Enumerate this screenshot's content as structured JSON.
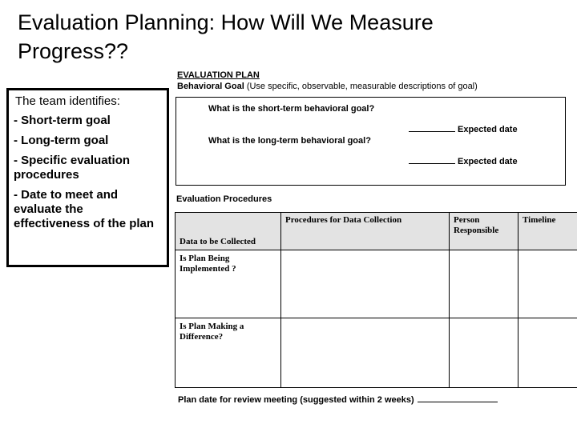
{
  "slide": {
    "title": "Evaluation Planning: How Will We Measure Progress??"
  },
  "team_panel": {
    "lead": "The team identifies:",
    "items": [
      "- Short-term goal",
      "- Long-term goal",
      "- Specific  evaluation\n            procedures",
      "- Date to meet and evaluate the effectiveness of the plan"
    ]
  },
  "eval_plan": {
    "heading": "EVALUATION PLAN",
    "behavioral_goal_label": "Behavioral Goal",
    "behavioral_goal_note": " (Use specific, observable, measurable descriptions of goal)",
    "short_term_question": "What is the short-term behavioral goal?",
    "long_term_question": "What is the long-term behavioral goal?",
    "expected_date_label_1": "Expected date",
    "expected_date_label_2": "Expected date"
  },
  "eval_procedures": {
    "label": "Evaluation Procedures",
    "columns": [
      "Data to be Collected",
      "Procedures for Data Collection",
      "Person Responsible",
      "Timeline"
    ],
    "rows": [
      {
        "data_to_be_collected": "Is Plan Being Implemented ?",
        "procedures_for_data_collection": "",
        "person_responsible": "",
        "timeline": ""
      },
      {
        "data_to_be_collected": "Is Plan Making a Difference?",
        "procedures_for_data_collection": "",
        "person_responsible": "",
        "timeline": ""
      }
    ]
  },
  "footer": {
    "plan_date_text": "Plan date for review meeting (suggested within 2 weeks)"
  },
  "colors": {
    "header_fill": "#e3e3e3",
    "border": "#000000",
    "text": "#000000",
    "background": "#ffffff"
  }
}
